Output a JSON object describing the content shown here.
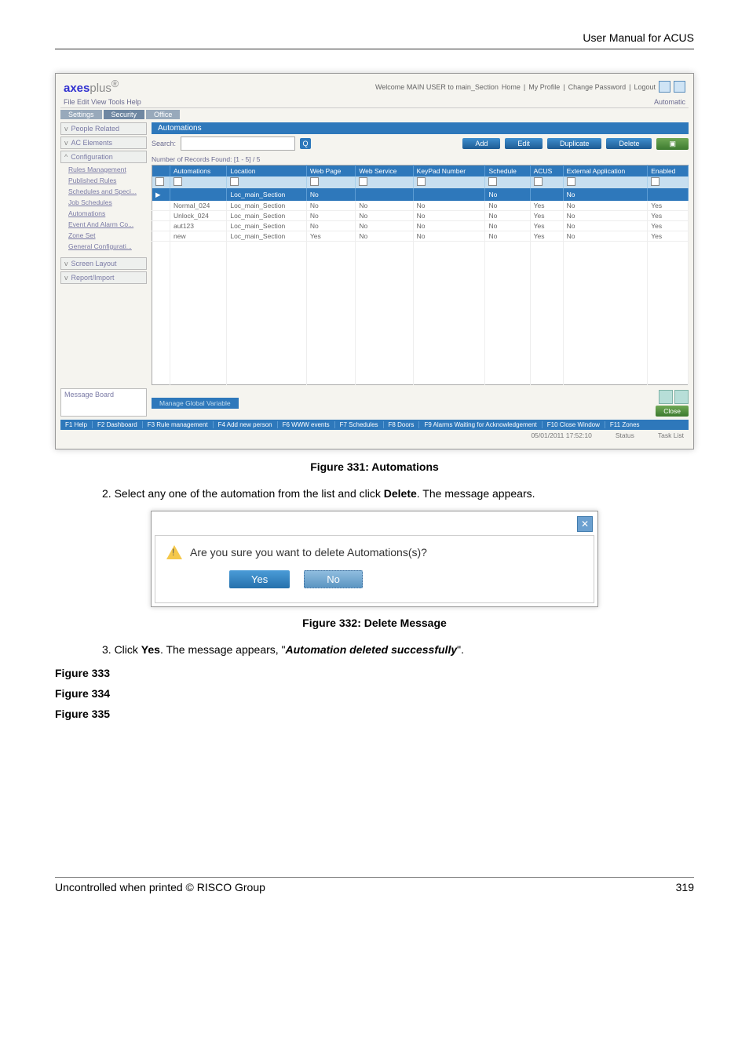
{
  "page": {
    "header": "User Manual for ACUS",
    "figure_331": "Figure 331: Automations",
    "step2": "2.   Select any one of the automation from the list and click ",
    "step2_bold": "Delete",
    "step2_tail": ". The message appears.",
    "dialog_msg": "Are you sure you want to delete Automations(s)?",
    "yes": "Yes",
    "no": "No",
    "figure_332": "Figure 332: Delete Message",
    "step3_pre": "3.   Click ",
    "step3_yes": "Yes",
    "step3_mid": ". The message appears, \"",
    "step3_auto": "Automation deleted successfully",
    "step3_tail": "\".",
    "fig333": "Figure 333",
    "fig334": "Figure 334",
    "fig335": "Figure 335",
    "footer_left": "Uncontrolled when printed © RISCO Group",
    "footer_right": "319"
  },
  "app": {
    "logo_pre": "axes",
    "logo_post": "plus",
    "welcome": "Welcome MAIN USER to main_Section",
    "home": "Home",
    "my_profile": "My Profile",
    "change_password": "Change Password",
    "logout": "Logout",
    "menu": "File   Edit   View   Tools   Help",
    "automatic_label": "Automatic",
    "tabs": [
      "Settings",
      "Security",
      "Office"
    ],
    "sidebar": {
      "people": "People Related",
      "ac": "AC Elements",
      "config": "Configuration",
      "items": [
        "Rules Management",
        "Published Rules",
        "Schedules and Speci...",
        "Job Schedules",
        "Automations",
        "Event And Alarm Co...",
        "Zone Set",
        "General Configurati..."
      ],
      "screen_layout": "Screen Layout",
      "report": "Report/Import",
      "message_board": "Message Board"
    },
    "panel": {
      "title": "Automations",
      "search_label": "Search:",
      "search_icon": "Q",
      "buttons": {
        "add": "Add",
        "edit": "Edit",
        "duplicate": "Duplicate",
        "delete": "Delete"
      },
      "record_count": "Number of Records Found: [1 - 5] / 5",
      "columns": [
        "",
        "Automations",
        "Location",
        "Web Page",
        "Web Service",
        "KeyPad Number",
        "Schedule",
        "ACUS",
        "External Application",
        "Enabled"
      ],
      "sel_row": [
        "▶",
        "",
        "Loc_main_Section",
        "No",
        "",
        "",
        "No",
        "",
        "No",
        ""
      ],
      "rows": [
        [
          "",
          "Normal_024",
          "Loc_main_Section",
          "No",
          "No",
          "No",
          "No",
          "Yes",
          "No",
          "Yes"
        ],
        [
          "",
          "Unlock_024",
          "Loc_main_Section",
          "No",
          "No",
          "No",
          "No",
          "Yes",
          "No",
          "Yes"
        ],
        [
          "",
          "aut123",
          "Loc_main_Section",
          "No",
          "No",
          "No",
          "No",
          "Yes",
          "No",
          "Yes"
        ],
        [
          "",
          "new",
          "Loc_main_Section",
          "Yes",
          "No",
          "No",
          "No",
          "Yes",
          "No",
          "Yes"
        ]
      ],
      "footer_btn": "Manage Global Variable",
      "close_btn": "Close"
    },
    "status_segments": [
      "F1 Help",
      "F2 Dashboard",
      "F3 Rule management",
      "F4 Add new person",
      "F6 WWW events",
      "F7 Schedules",
      "F8 Doors",
      "F9 Alarms Waiting for Acknowledgement",
      "F10 Close Window",
      "F11 Zones"
    ],
    "status_right": {
      "time": "05/01/2011 17:52:10",
      "status": "Status",
      "task": "Task List"
    }
  }
}
